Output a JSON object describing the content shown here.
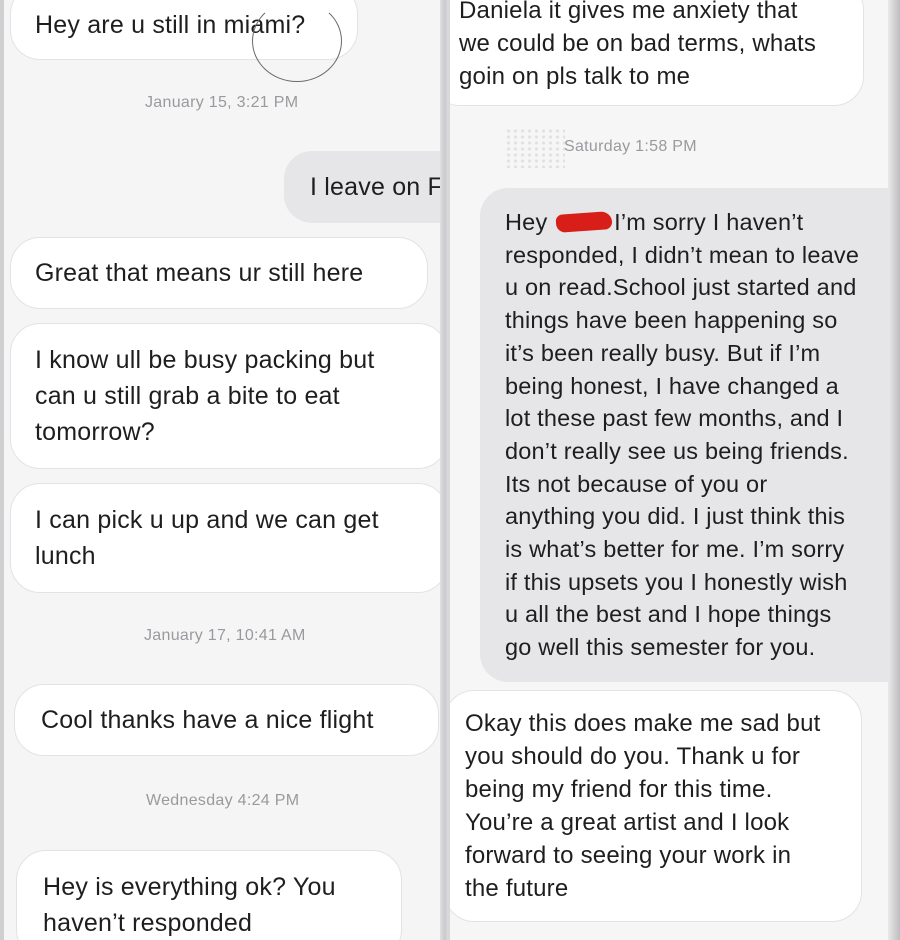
{
  "left": {
    "msg_miami": "Hey are u still in miami?",
    "stamp_jan15": "January 15, 3:21 PM",
    "msg_leave": "I leave on F",
    "msg_great": "Great that means ur still here",
    "msg_packing": [
      "I know ull be busy packing but",
      "can u still grab a bite to eat",
      "tomorrow?"
    ],
    "msg_pickup": [
      "I can pick u up and we can get",
      "lunch"
    ],
    "stamp_jan17": "January 17, 10:41 AM",
    "msg_cool": "Cool thanks have a nice flight",
    "stamp_wed": "Wednesday 4:24 PM",
    "msg_everything": [
      "Hey is everything ok? You",
      "haven’t responded"
    ]
  },
  "right": {
    "msg_anxiety": [
      "Daniela it gives me anxiety that",
      "we could be on bad terms, whats",
      "goin on pls talk to me"
    ],
    "stamp_sat": "Saturday 1:58 PM",
    "msg_reply_first_prefix": "Hey",
    "msg_reply_first_suffix": "I’m sorry I haven’t",
    "msg_reply": [
      "responded, I didn’t mean to leave",
      "u on read.School just started and",
      "things have been happening so",
      "it’s been really busy. But if I’m",
      "being honest, I have changed a",
      "lot these past few months, and I",
      "don’t really see us being friends.",
      "Its not because of you or",
      "anything you did. I just think this",
      "is what’s better for me. I’m sorry",
      "if this upsets you I honestly wish",
      "u all the best and I hope things",
      "go well this semester for you."
    ],
    "msg_okay": [
      "Okay this does make me sad but",
      "you should do you. Thank u for",
      "being my friend for this time.",
      "You’re a great artist and I look",
      "forward to seeing your work in",
      "the future"
    ]
  },
  "colors": {
    "incoming_bubble": "#ffffff",
    "outgoing_bubble": "#e6e6e8",
    "timestamp": "#9a9a9e",
    "redaction": "#d81e18"
  }
}
